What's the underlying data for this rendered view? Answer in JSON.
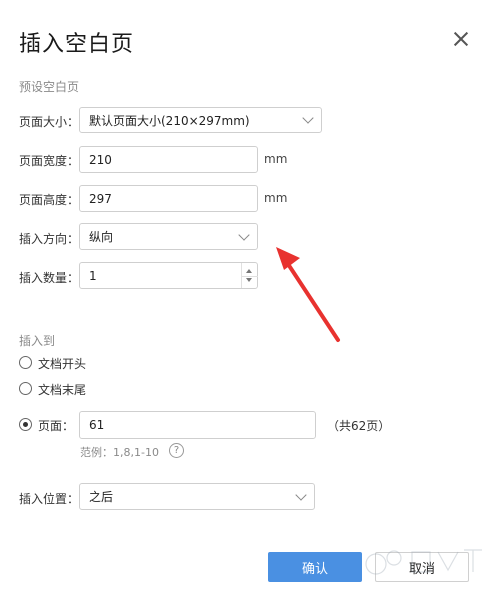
{
  "dialog": {
    "title": "插入空白页"
  },
  "preset": {
    "section_label": "预设空白页",
    "page_size_label": "页面大小：",
    "page_size_value": "默认页面大小(210×297mm)",
    "width_label": "页面宽度：",
    "width_value": "210",
    "width_unit": "mm",
    "height_label": "页面高度：",
    "height_value": "297",
    "height_unit": "mm",
    "orientation_label": "插入方向：",
    "orientation_value": "纵向",
    "count_label": "插入数量：",
    "count_value": "1"
  },
  "insert_to": {
    "section_label": "插入到",
    "option_start": "文档开头",
    "option_end": "文档末尾",
    "option_page": "页面：",
    "page_value": "61",
    "total_pages": "（共62页）",
    "example": "范例：1,8,1-10",
    "help_icon": "?"
  },
  "position": {
    "label": "插入位置：",
    "value": "之后"
  },
  "buttons": {
    "confirm": "确认",
    "cancel": "取消"
  },
  "colors": {
    "primary": "#4a90e2",
    "annotation_arrow": "#e8322f"
  }
}
